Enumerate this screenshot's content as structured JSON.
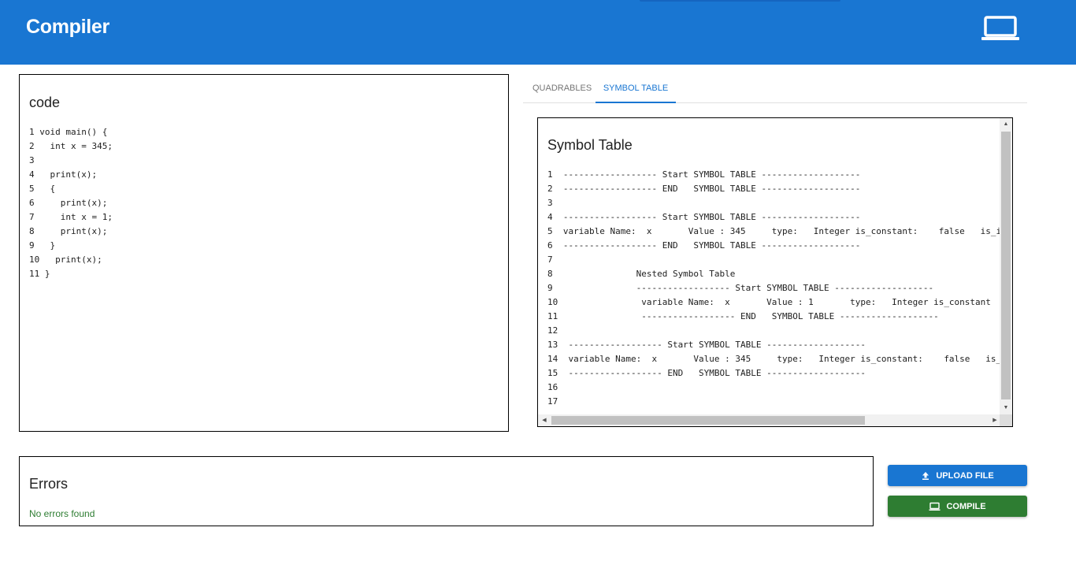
{
  "header": {
    "title": "Compiler",
    "icon": "laptop-icon",
    "bg_color": "#1976d2"
  },
  "code_panel": {
    "title": "code",
    "lines": [
      "1 void main() {",
      "2   int x = 345;",
      "3",
      "4   print(x);",
      "5   {",
      "6     print(x);",
      "7     int x = 1;",
      "8     print(x);",
      "9   }",
      "10   print(x);",
      "11 }"
    ]
  },
  "tabs": [
    {
      "label": "QUADRABLES",
      "active": false
    },
    {
      "label": "SYMBOL TABLE",
      "active": true
    }
  ],
  "symbol_panel": {
    "title": "Symbol Table",
    "lines": [
      "1  ------------------ Start SYMBOL TABLE -------------------",
      "2  ------------------ END   SYMBOL TABLE -------------------",
      "3",
      "4  ------------------ Start SYMBOL TABLE -------------------",
      "5  variable Name:  x       Value : 345     type:   Integer is_constant:    false   is_i",
      "6  ------------------ END   SYMBOL TABLE -------------------",
      "7",
      "8                Nested Symbol Table",
      "9                ------------------ Start SYMBOL TABLE -------------------",
      "10                variable Name:  x       Value : 1       type:   Integer is_constant",
      "11                ------------------ END   SYMBOL TABLE -------------------",
      "12",
      "13  ------------------ Start SYMBOL TABLE -------------------",
      "14  variable Name:  x       Value : 345     type:   Integer is_constant:    false   is_",
      "15  ------------------ END   SYMBOL TABLE -------------------",
      "16",
      "17"
    ]
  },
  "errors_panel": {
    "title": "Errors",
    "message": "No errors found",
    "message_color": "#2e7d32"
  },
  "buttons": {
    "upload": {
      "label": "UPLOAD FILE",
      "icon": "upload-icon",
      "color": "#1976d2"
    },
    "compile": {
      "label": "COMPILE",
      "icon": "laptop-icon",
      "color": "#2e7d32"
    }
  }
}
